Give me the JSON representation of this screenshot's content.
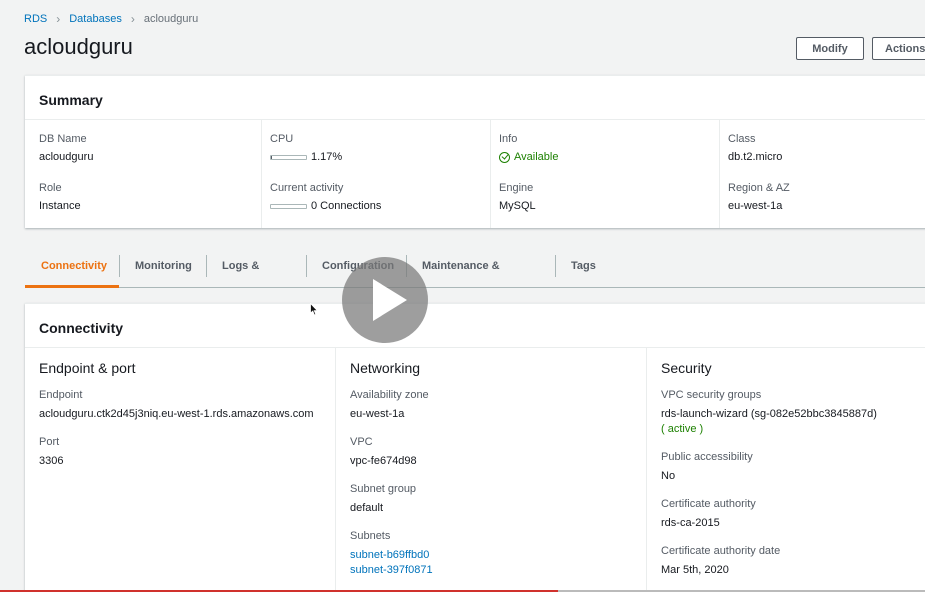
{
  "breadcrumb": {
    "rds": "RDS",
    "databases": "Databases",
    "current": "acloudguru"
  },
  "page": {
    "title": "acloudguru"
  },
  "header": {
    "modify_label": "Modify",
    "actions_label": "Actions"
  },
  "summary": {
    "title": "Summary",
    "db_name_label": "DB Name",
    "db_name_value": "acloudguru",
    "role_label": "Role",
    "role_value": "Instance",
    "cpu_label": "CPU",
    "cpu_value": "1.17%",
    "cpu_fraction": 0.0117,
    "activity_label": "Current activity",
    "activity_value": "0 Connections",
    "activity_fraction": 0,
    "info_label": "Info",
    "info_value": "Available",
    "engine_label": "Engine",
    "engine_value": "MySQL",
    "class_label": "Class",
    "class_value": "db.t2.micro",
    "region_label": "Region & AZ",
    "region_value": "eu-west-1a"
  },
  "tabs": [
    {
      "label": "Connectivity"
    },
    {
      "label": "Monitoring"
    },
    {
      "label": "Logs & events"
    },
    {
      "label": "Configuration"
    },
    {
      "label": "Maintenance & backups"
    },
    {
      "label": "Tags"
    }
  ],
  "connectivity": {
    "title": "Connectivity",
    "endpoint_section": {
      "heading": "Endpoint & port",
      "endpoint_label": "Endpoint",
      "endpoint_value": "acloudguru.ctk2d45j3niq.eu-west-1.rds.amazonaws.com",
      "port_label": "Port",
      "port_value": "3306"
    },
    "networking_section": {
      "heading": "Networking",
      "az_label": "Availability zone",
      "az_value": "eu-west-1a",
      "vpc_label": "VPC",
      "vpc_value": "vpc-fe674d98",
      "subnet_group_label": "Subnet group",
      "subnet_group_value": "default",
      "subnets_label": "Subnets",
      "subnets": [
        "subnet-b69ffbd0",
        "subnet-397f0871"
      ]
    },
    "security_section": {
      "heading": "Security",
      "sg_label": "VPC security groups",
      "sg_value": "rds-launch-wizard (sg-082e52bbc3845887d)",
      "sg_status": "( active )",
      "public_label": "Public accessibility",
      "public_value": "No",
      "ca_label": "Certificate authority",
      "ca_value": "rds-ca-2015",
      "ca_date_label": "Certificate authority date",
      "ca_date_value": "Mar 5th, 2020"
    }
  },
  "video": {
    "progress_fraction": 0.603
  },
  "colors": {
    "link": "#0073bb",
    "accent": "#ec7211",
    "success": "#1d8102"
  }
}
